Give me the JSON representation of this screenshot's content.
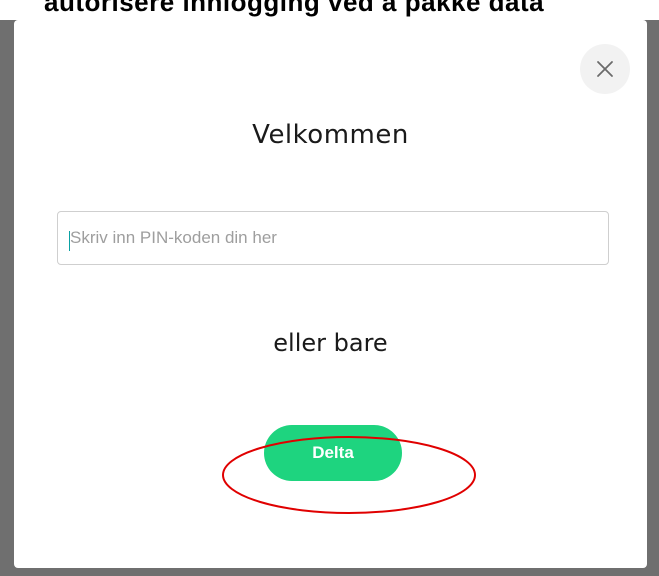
{
  "header_fragment": {
    "text": "autorisere innlogging ved å pakke data"
  },
  "modal": {
    "close_icon": "close-icon",
    "title": "Velkommen",
    "pin_input": {
      "value": "",
      "placeholder": "Skriv inn PIN-koden din her"
    },
    "or_text": "eller bare",
    "join_button_label": "Delta"
  },
  "colors": {
    "overlay": "#6f6f6f",
    "accent_green": "#1ed47f",
    "highlight_red": "#e00000",
    "caret_teal": "#0aa2a4"
  }
}
